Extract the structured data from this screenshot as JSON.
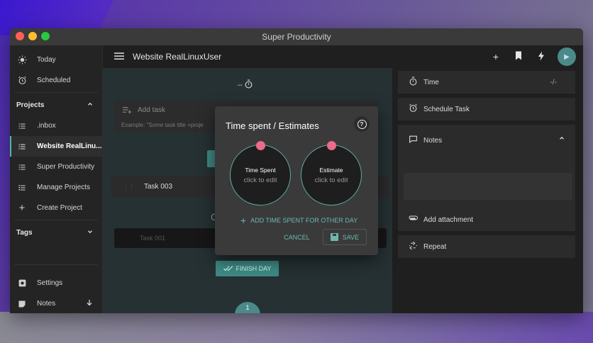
{
  "window": {
    "title": "Super Productivity"
  },
  "sidebar": {
    "top_items": [
      {
        "label": "Today",
        "icon": "sun-icon"
      },
      {
        "label": "Scheduled",
        "icon": "alarm-icon"
      }
    ],
    "projects_header": "Projects",
    "projects": [
      {
        "label": ".inbox"
      },
      {
        "label": "Website RealLinu..."
      },
      {
        "label": "Super Productivity"
      },
      {
        "label": "Manage Projects"
      },
      {
        "label": "Create Project"
      }
    ],
    "tags_header": "Tags",
    "bottom_items": [
      {
        "label": "Settings"
      },
      {
        "label": "Notes"
      }
    ]
  },
  "main": {
    "header_title": "Website RealLinuxUser",
    "timer_prefix": "--",
    "add_task_placeholder": "Add task",
    "add_task_example": "Example: \"Some task title +proje",
    "tasks": [
      {
        "title": "Task 003"
      },
      {
        "title": "Task 001"
      }
    ],
    "ghost_letter": "C",
    "finish_day_label": "FINISH DAY",
    "fab_count": "1"
  },
  "right_panel": {
    "time_label": "Time",
    "time_value": "-/-",
    "schedule_label": "Schedule Task",
    "notes_label": "Notes",
    "attachment_label": "Add attachment",
    "repeat_label": "Repeat"
  },
  "dialog": {
    "title": "Time spent / Estimates",
    "time_spent_label": "Time Spent",
    "time_spent_hint": "click to edit",
    "estimate_label": "Estimate",
    "estimate_hint": "click to edit",
    "add_time_label": "ADD TIME SPENT FOR OTHER DAY",
    "cancel_label": "CANCEL",
    "save_label": "SAVE"
  },
  "colors": {
    "accent": "#4db6ac",
    "knob": "#ec6a8a"
  }
}
